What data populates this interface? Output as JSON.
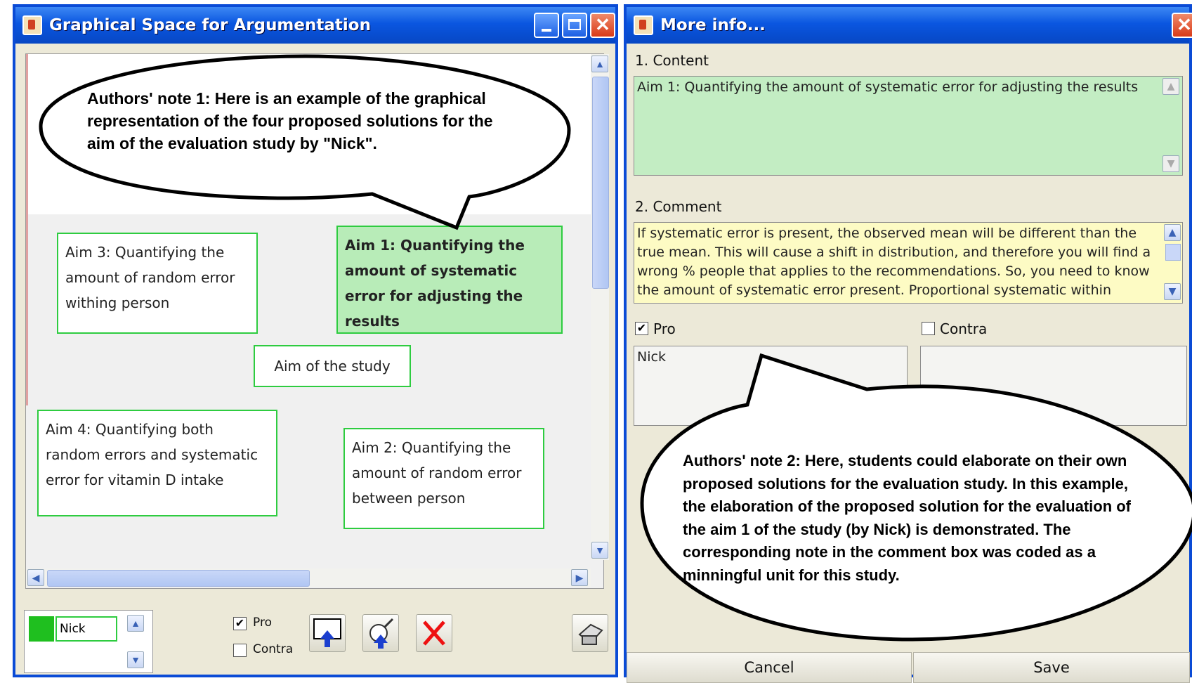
{
  "left_window": {
    "title": "Graphical Space for Argumentation",
    "note": "Authors' note 1: Here is an example of the graphical representation of the four proposed solutions for the aim of the evaluation study by \"Nick\".",
    "nodes": {
      "aim3": "Aim 3: Quantifying the amount of random error withing person",
      "aim1": "Aim 1: Quantifying the amount of systematic error for adjusting the results",
      "center": "Aim of the study",
      "aim4": "Aim 4: Quantifying both random errors and systematic error for vitamin D intake",
      "aim2": "Aim 2: Quantifying the amount of random error between person"
    },
    "user_field": "Nick",
    "pro_label": "Pro",
    "contra_label": "Contra",
    "user_color": "#1fbf1f"
  },
  "right_window": {
    "title": "More info...",
    "content_label": "1. Content",
    "content_text": "Aim 1: Quantifying the amount of systematic error for adjusting the results",
    "comment_label": "2. Comment",
    "comment_text": "If systematic error is present, the observed mean will be different than the true mean. This will cause a shift in distribution, and therefore you will find a wrong % people that applies to the recommendations. So, you need to know the amount of systematic error present.  Proportional systematic within",
    "pro_label": "Pro",
    "contra_label": "Contra",
    "pro_box": "Nick",
    "note": "Authors' note 2: Here, students could elaborate on their own proposed solutions for the evaluation study. In this example, the elaboration of the proposed solution for the evaluation of the aim 1 of the study (by Nick) is demonstrated. The corresponding note in the comment box was coded as a minningful unit for this study.",
    "cancel_label": "Cancel",
    "save_label": "Save"
  },
  "colors": {
    "content_bg": "#c3edc3",
    "comment_bg": "#fdfbc4",
    "node_border": "#2ecc40",
    "titlebar": "#0a56e0"
  }
}
